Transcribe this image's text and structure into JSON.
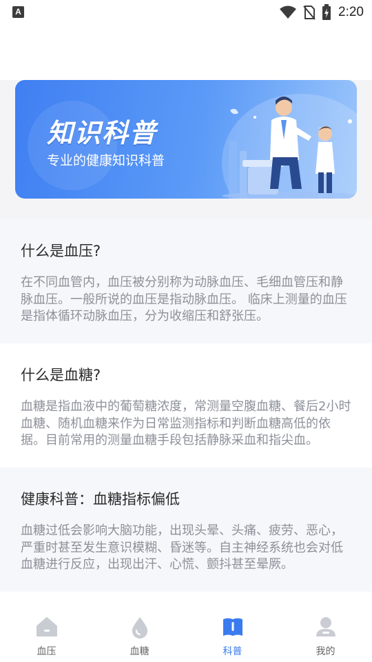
{
  "status_bar": {
    "notification_icon": "A",
    "time": "2:20",
    "icons": [
      "wifi-icon",
      "no-sim-icon",
      "battery-charging-icon"
    ]
  },
  "banner": {
    "title": "知识科普",
    "subtitle": "专业的健康知识科普",
    "colors": {
      "gradient_start": "#3f7ff2",
      "gradient_end": "#9cc6fb"
    }
  },
  "articles": [
    {
      "title": "什么是血压?",
      "summary": "在不同血管内，血压被分别称为动脉血压、毛细血管压和静脉血压。一般所说的血压是指动脉血压。 临床上测量的血压是指体循环动脉血压，分为收缩压和舒张压。"
    },
    {
      "title": "什么是血糖?",
      "summary": "血糖是指血液中的葡萄糖浓度，常测量空腹血糖、餐后2小时血糖、随机血糖来作为日常监测指标和判断血糖高低的依据。目前常用的测量血糖手段包括静脉采血和指尖血。"
    },
    {
      "title": "健康科普：血糖指标偏低",
      "summary": "血糖过低会影响大脑功能，出现头晕、头痛、疲劳、恶心，严重时甚至发生意识模糊、昏迷等。自主神经系统也会对低血糖进行反应，出现出汗、心慌、颤抖甚至晕厥。"
    }
  ],
  "bottom_nav": {
    "active_color": "#3a7cf0",
    "inactive_color": "#c9ccd3",
    "items": [
      {
        "label": "血压",
        "icon": "home-icon"
      },
      {
        "label": "血糖",
        "icon": "drop-icon"
      },
      {
        "label": "科普",
        "icon": "book-icon",
        "active": true
      },
      {
        "label": "我的",
        "icon": "user-icon"
      }
    ]
  }
}
